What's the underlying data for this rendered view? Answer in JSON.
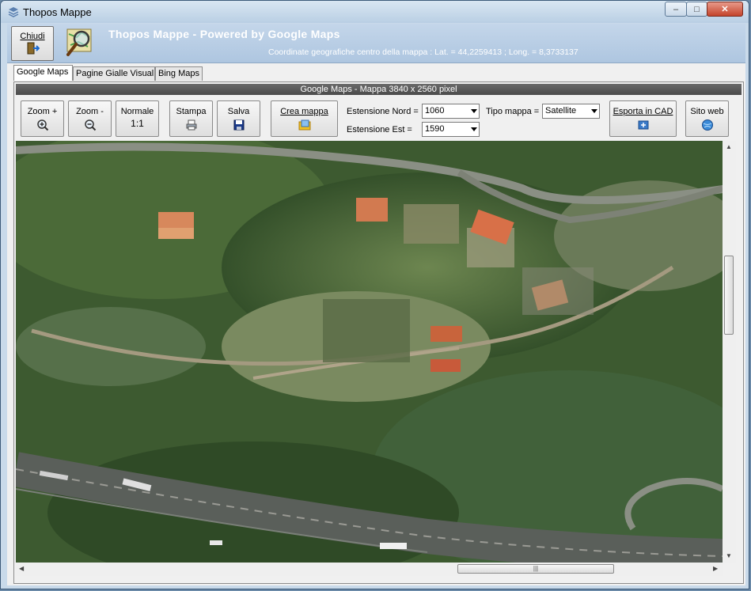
{
  "window": {
    "title": "Thopos Mappe",
    "minimize": "–",
    "maximize": "□",
    "close": "✕"
  },
  "header": {
    "close_label": "Chiudi",
    "title": "Thopos Mappe - Powered by Google Maps",
    "coords": "Coordinate geografiche centro della mappa : Lat. = 44,2259413 ; Long. = 8,3733137"
  },
  "tabs": [
    "Google Maps",
    "Pagine Gialle Visual",
    "Bing Maps"
  ],
  "map_caption": "Google Maps - Mappa  3840 x 2560 pixel",
  "toolbar": {
    "zoom_in": "Zoom +",
    "zoom_out": "Zoom -",
    "normal": "Normale",
    "normal_icon": "1:1",
    "print": "Stampa",
    "save": "Salva",
    "create_map": "Crea mappa",
    "extent_north_label": "Estensione Nord =",
    "extent_north_value": "1060",
    "extent_east_label": "Estensione Est =",
    "extent_east_value": "1590",
    "map_type_label": "Tipo mappa =",
    "map_type_value": "Satellite",
    "export_cad": "Esporta in CAD",
    "website": "Sito web"
  },
  "scrollbar": {
    "grip": "|||"
  },
  "icons": [
    "app-icon",
    "exit-door-icon",
    "magnifier-map-icon",
    "zoom-in-icon",
    "zoom-out-icon",
    "printer-icon",
    "floppy-disk-icon",
    "map-folder-icon",
    "cad-export-icon",
    "globe-icon"
  ]
}
